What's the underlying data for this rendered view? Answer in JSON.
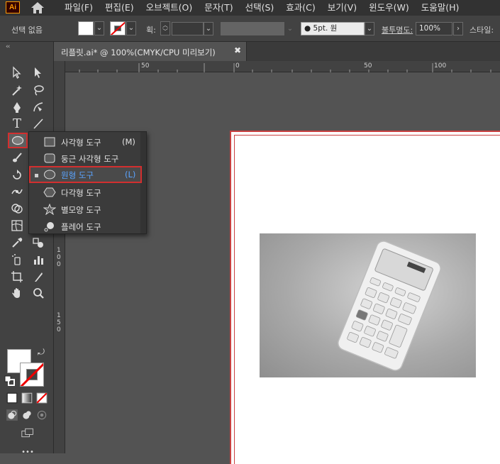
{
  "app": {
    "logo": "Ai"
  },
  "menu": [
    "파일(F)",
    "편집(E)",
    "오브젝트(O)",
    "문자(T)",
    "선택(S)",
    "효과(C)",
    "보기(V)",
    "윈도우(W)",
    "도움말(H)"
  ],
  "control": {
    "selection": "선택 없음",
    "stroke_label": "획:",
    "brush": "5pt. 원",
    "opacity_label": "불투명도:",
    "opacity": "100%",
    "style_label": "스타일:"
  },
  "tab": {
    "title": "리플릿.ai* @ 100%(CMYK/CPU 미리보기)",
    "close": "✖"
  },
  "ruler": {
    "h": [
      "50",
      "0",
      "50",
      "100"
    ],
    "v": [
      "5",
      "0",
      "1",
      "0",
      "0",
      "1",
      "5",
      "0"
    ]
  },
  "flyout": {
    "items": [
      {
        "label": "사각형 도구",
        "key": "(M)",
        "selected": false,
        "icon": "rectangle-icon"
      },
      {
        "label": "둥근 사각형 도구",
        "key": "",
        "selected": false,
        "icon": "rounded-rectangle-icon"
      },
      {
        "label": "원형 도구",
        "key": "(L)",
        "selected": true,
        "icon": "ellipse-icon"
      },
      {
        "label": "다각형 도구",
        "key": "",
        "selected": false,
        "icon": "polygon-icon"
      },
      {
        "label": "별모양 도구",
        "key": "",
        "selected": false,
        "icon": "star-icon"
      },
      {
        "label": "플레어 도구",
        "key": "",
        "selected": false,
        "icon": "flare-icon"
      }
    ]
  },
  "toolbar": {
    "more": "•••",
    "collapse": "‹‹"
  },
  "colors": {
    "accent_red": "#d32f2f",
    "selected_text": "#5aa4ff",
    "panel": "#424242",
    "canvas": "#535353"
  }
}
